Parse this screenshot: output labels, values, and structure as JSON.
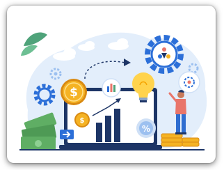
{
  "image": {
    "subject": "business-growth-illustration",
    "colors": {
      "background_blob": "#e3eefb",
      "accent_blue": "#2c6fd8",
      "navy": "#1d3566",
      "coin_gold": "#f5b324",
      "coin_dark": "#d98a12",
      "bulb_yellow": "#ffd34d",
      "leaf_green": "#4fa37a",
      "money_green": "#5fae64",
      "person_shirt": "#e9756a",
      "person_pants": "#2f6dd0"
    },
    "icons": [
      "dollar-coin-icon",
      "gear-icon",
      "lightbulb-icon",
      "bar-chart-icon",
      "percent-icon",
      "people-team-icon"
    ],
    "symbols": {
      "dollar": "$",
      "percent": "%"
    }
  }
}
